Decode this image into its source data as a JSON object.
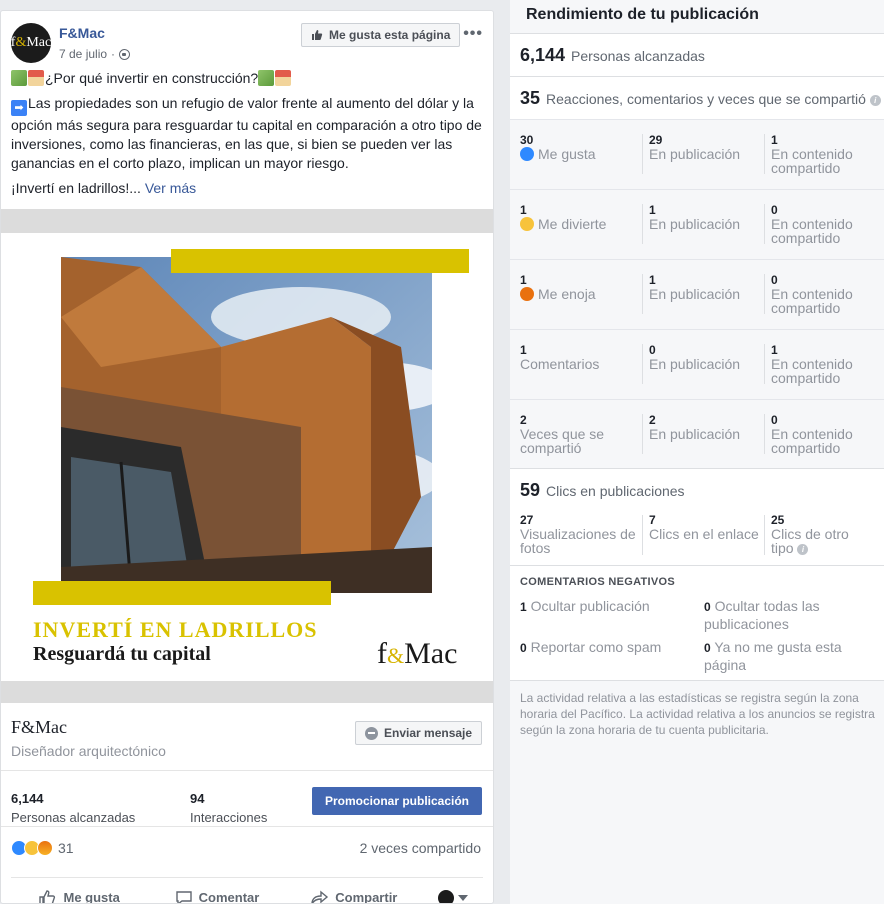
{
  "post": {
    "page_name": "F&Mac",
    "avatar_text": "f&Mac",
    "date": "7 de julio",
    "date_sep": "·",
    "like_page_label": "Me gusta esta página",
    "more": "•••",
    "text_line1": "¿Por qué invertir en construcción?",
    "text_para2": "Las propiedades son un refugio de valor frente al aumento del dólar y la opción más segura para resguardar tu capital en comparación a otro tipo de inversiones, como las financieras, en las que, si bien se pueden ver las ganancias en el corto plazo, implican un mayor riesgo.",
    "text_line3": "¡Invertí en ladrillos!...",
    "see_more": "Ver más",
    "image": {
      "title": "INVERTÍ EN LADRILLOS",
      "subtitle": "Resguardá tu capital",
      "logo_f": "f",
      "logo_amp": "&",
      "logo_mac": "Mac"
    },
    "page_info": {
      "name": "F&Mac",
      "category": "Diseñador arquitectónico",
      "send_message_label": "Enviar mensaje"
    },
    "stats": {
      "reach_value": "6,144",
      "reach_label": "Personas alcanzadas",
      "interactions_value": "94",
      "interactions_label": "Interacciones",
      "promote_label": "Promocionar publicación"
    },
    "reactions": {
      "count": "31",
      "shares": "2 veces compartido"
    },
    "actions": {
      "like": "Me gusta",
      "comment": "Comentar",
      "share": "Compartir"
    }
  },
  "insights": {
    "title": "Rendimiento de tu publicación",
    "reached_value": "6,144",
    "reached_label": "Personas alcanzadas",
    "engagement_value": "35",
    "engagement_label": "Reacciones, comentarios y veces que se compartió",
    "info_icon": "i",
    "rows": [
      {
        "a_num": "30",
        "a_lbl": "Me gusta",
        "a_icon": "like",
        "b_num": "29",
        "b_lbl": "En publicación",
        "c_num": "1",
        "c_lbl1": "En contenido",
        "c_lbl2": "compartido"
      },
      {
        "a_num": "1",
        "a_lbl": "Me divierte",
        "a_icon": "haha",
        "b_num": "1",
        "b_lbl": "En publicación",
        "c_num": "0",
        "c_lbl1": "En contenido",
        "c_lbl2": "compartido"
      },
      {
        "a_num": "1",
        "a_lbl": "Me enoja",
        "a_icon": "angry",
        "b_num": "1",
        "b_lbl": "En publicación",
        "c_num": "0",
        "c_lbl1": "En contenido",
        "c_lbl2": "compartido"
      },
      {
        "a_num": "1",
        "a_lbl": "Comentarios",
        "a_icon": "",
        "b_num": "0",
        "b_lbl": "En publicación",
        "c_num": "1",
        "c_lbl1": "En contenido",
        "c_lbl2": "compartido"
      },
      {
        "a_num": "2",
        "a_lbl": "Veces que se",
        "a_lbl2": "compartió",
        "a_icon": "",
        "b_num": "2",
        "b_lbl": "En publicación",
        "c_num": "0",
        "c_lbl1": "En contenido",
        "c_lbl2": "compartido"
      }
    ],
    "clicks_value": "59",
    "clicks_label": "Clics en publicaciones",
    "clicks": {
      "photos_num": "27",
      "photos_lbl1": "Visualizaciones de",
      "photos_lbl2": "fotos",
      "link_num": "7",
      "link_lbl": "Clics en el enlace",
      "other_num": "25",
      "other_lbl1": "Clics de otro",
      "other_lbl2": "tipo"
    },
    "negative_title": "COMENTARIOS NEGATIVOS",
    "negative": {
      "hide_num": "1",
      "hide_lbl": "Ocultar publicación",
      "hide_all_num": "0",
      "hide_all_lbl1": "Ocultar todas las",
      "hide_all_lbl2": "publicaciones",
      "spam_num": "0",
      "spam_lbl": "Reportar como spam",
      "unlike_num": "0",
      "unlike_lbl1": "Ya no me gusta esta",
      "unlike_lbl2": "página"
    },
    "footnote": "La actividad relativa a las estadísticas se registra según la zona horaria del Pacífico. La actividad relativa a los anuncios se registra según la zona horaria de tu cuenta publicitaria."
  },
  "colors": {
    "fb_blue": "#4267b2",
    "link_blue": "#385898",
    "brand_yellow": "#d9c200",
    "like_blue": "#2e89ff",
    "haha_yellow": "#f7c33b",
    "angry_orange": "#e9710f"
  }
}
